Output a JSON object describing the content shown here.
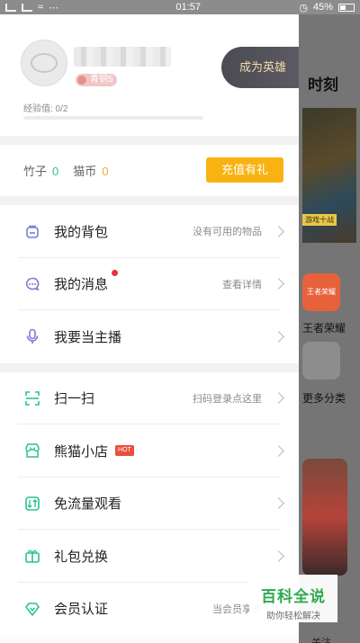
{
  "status_bar": {
    "time": "01:57",
    "battery": "45%"
  },
  "background": {
    "title": "时刻",
    "apps": [
      {
        "label": "王者荣耀",
        "icon_label": "王者荣耀",
        "color": "#e7623b"
      },
      {
        "label": "更多分类",
        "color": "#8d8d8d"
      }
    ],
    "banner_text": "游戏十战",
    "follow_label": "关注"
  },
  "profile": {
    "level_badge": "青铜5",
    "hero_button": "成为英雄",
    "exp_label": "经验值: 0/2",
    "exp_progress": 0
  },
  "wallet": {
    "bamboo_label": "竹子",
    "bamboo_value": "0",
    "cat_coin_label": "猫币",
    "cat_coin_value": "0",
    "recharge_button": "充值有礼"
  },
  "menu_group_1": [
    {
      "label": "我的背包",
      "hint": "没有可用的物品",
      "icon": "backpack-icon"
    },
    {
      "label": "我的消息",
      "hint": "查看详情",
      "icon": "message-icon"
    },
    {
      "label": "我要当主播",
      "hint": "",
      "icon": "microphone-icon"
    }
  ],
  "menu_group_2": [
    {
      "label": "扫一扫",
      "hint": "扫码登录点这里",
      "icon": "scan-icon"
    },
    {
      "label": "熊猫小店",
      "hint": "",
      "badge": "HOT",
      "icon": "store-icon"
    },
    {
      "label": "免流量观看",
      "hint": "",
      "icon": "free-data-icon"
    },
    {
      "label": "礼包兑换",
      "hint": "",
      "icon": "gift-icon"
    },
    {
      "label": "会员认证",
      "hint": "当会员享有",
      "icon": "diamond-icon"
    }
  ],
  "watermark": {
    "title": "百科全说",
    "subtitle": "助你轻松解决"
  },
  "colors": {
    "accent": "#f8b312",
    "green": "#2bc48a",
    "icon_purple": "#7b7bd8",
    "icon_green": "#2bc48a",
    "hot": "#ea4f3c"
  }
}
